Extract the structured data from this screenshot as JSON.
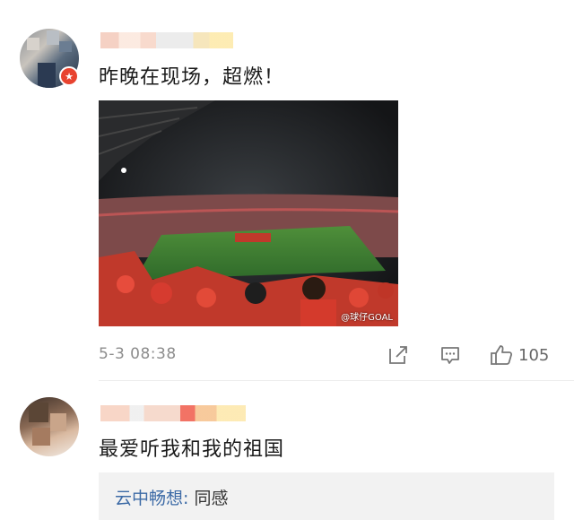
{
  "comment1": {
    "text": "昨晚在现场，超燃！",
    "timestamp": "5-3 08:38",
    "like_count": "105",
    "photo": {
      "watermark": "@球仔GOAL"
    }
  },
  "comment2": {
    "text": "最爱听我和我的祖国",
    "reply": {
      "author": "云中畅想",
      "separator": ": ",
      "text": "同感"
    }
  },
  "colors": {
    "link_blue": "#3c6aa6",
    "badge_red": "#e8432f",
    "meta_gray": "#8c8c8c"
  },
  "icons": [
    "repost-icon",
    "comment-icon",
    "thumbs-up-icon"
  ]
}
